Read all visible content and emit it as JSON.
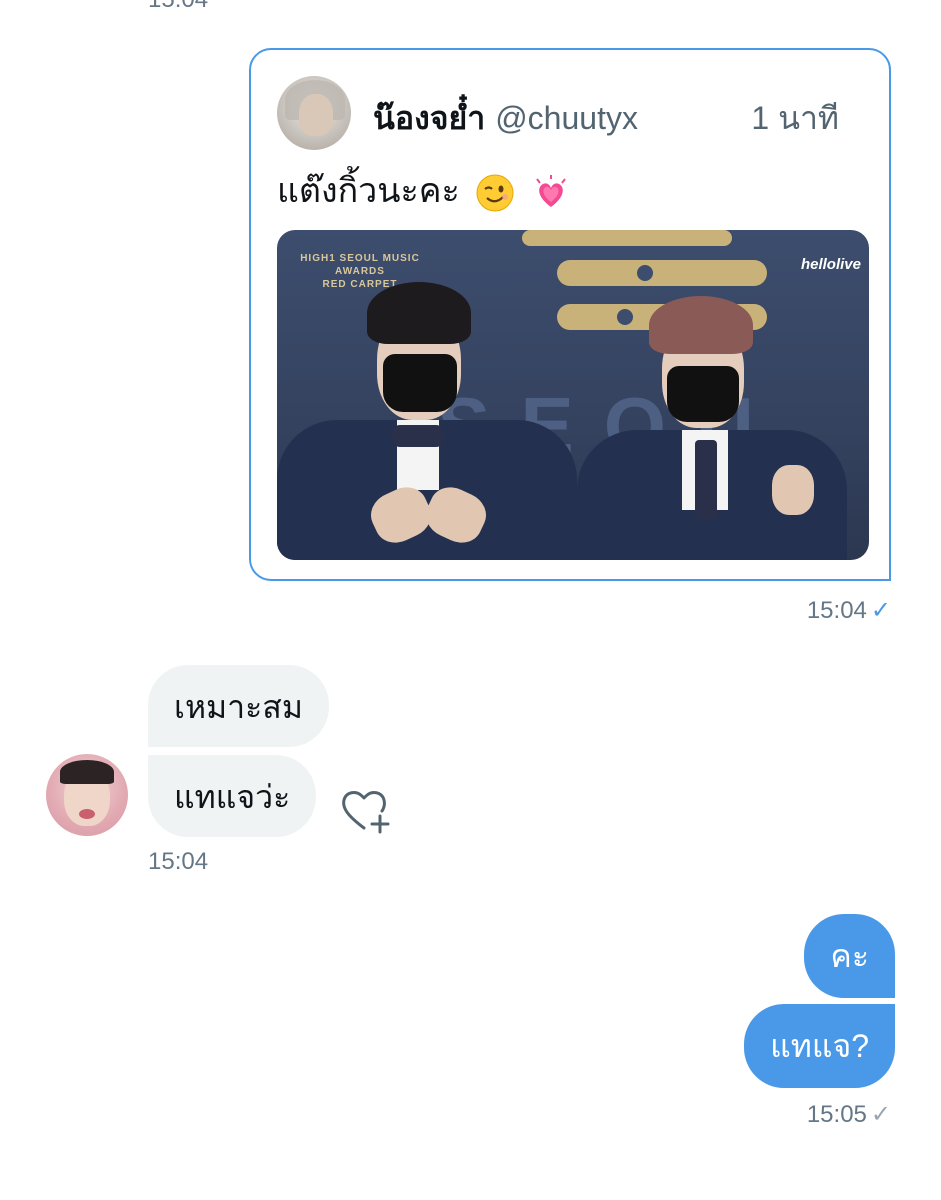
{
  "top_timestamp": "15:04",
  "quoted_tweet": {
    "author_name": "น๊องจย๋ำ",
    "author_handle": "@chuutyx",
    "relative_time": "1 นาที",
    "text": "แต๊งกิ้วนะคะ",
    "emojis": [
      "wink-emoji",
      "growing-heart-emoji"
    ],
    "media": {
      "overlay_left": "HIGH1 SEOUL MUSIC AWARDS",
      "overlay_left_sub": "RED CARPET",
      "overlay_right": "hellolive",
      "background_color": "#3d4d6d",
      "accent_color": "#c9b27a"
    },
    "timestamp": "15:04",
    "status_icon": "check-icon"
  },
  "incoming": {
    "messages": [
      "เหมาะสม",
      "แทแจว่ะ"
    ],
    "timestamp": "15:04",
    "bubble_color": "#eff3f4",
    "reaction_icon": "heart-add-icon"
  },
  "outgoing": {
    "messages": [
      "คะ",
      "แทแจ?"
    ],
    "timestamp": "15:05",
    "bubble_color": "#4a99e9",
    "status_icon": "check-icon"
  }
}
